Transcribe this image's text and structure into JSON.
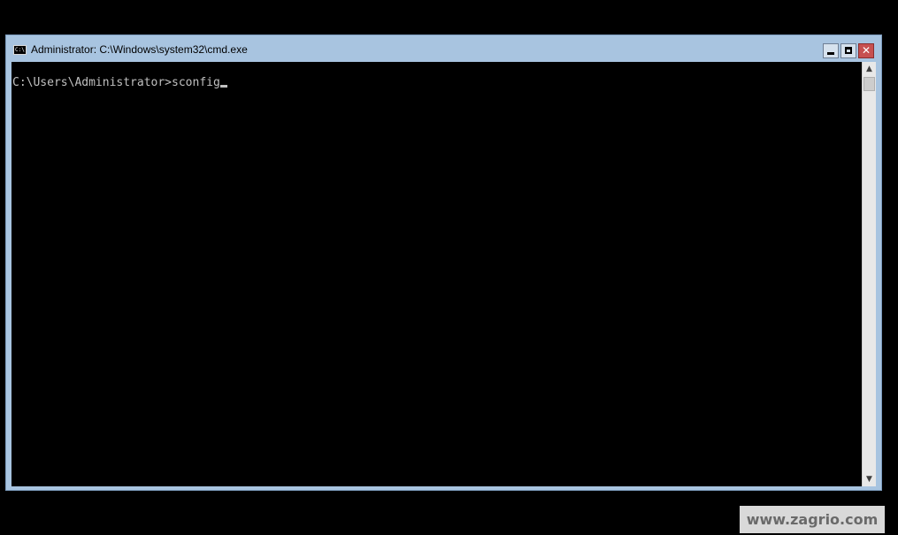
{
  "window": {
    "title": "Administrator: C:\\Windows\\system32\\cmd.exe",
    "icon": "cmd-icon",
    "icon_text": "C:\\",
    "controls": {
      "minimize_icon": "minimize-icon",
      "maximize_icon": "maximize-icon",
      "close_icon": "close-icon",
      "close_glyph": "✕",
      "close_color": "#c75050"
    }
  },
  "console": {
    "prompt": "C:\\Users\\Administrator>",
    "command": "sconfig",
    "background_color": "#000000",
    "text_color": "#c0c0c0"
  },
  "scrollbar": {
    "up_glyph": "▲",
    "down_glyph": "▼"
  },
  "watermark": {
    "text": "www.zagrio.com"
  }
}
